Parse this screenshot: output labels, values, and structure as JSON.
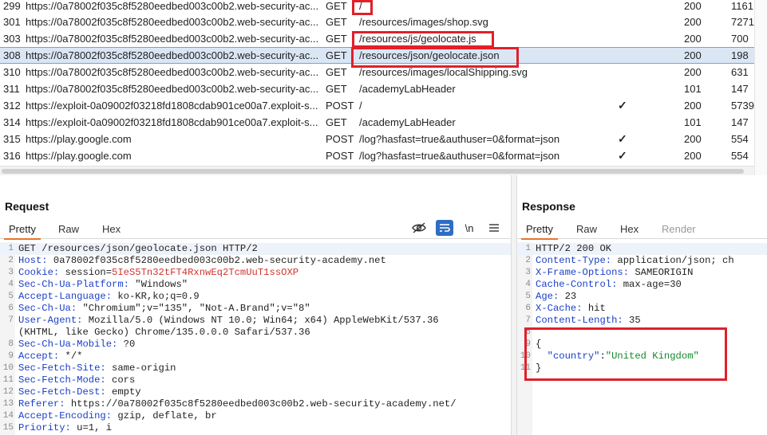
{
  "history": {
    "rows": [
      {
        "num": "299",
        "host": "https://0a78002f035c8f5280eedbed003c00b2.web-security-ac...",
        "method": "GET",
        "url": "/",
        "edited": false,
        "status": "200",
        "length": "1161"
      },
      {
        "num": "301",
        "host": "https://0a78002f035c8f5280eedbed003c00b2.web-security-ac...",
        "method": "GET",
        "url": "/resources/images/shop.svg",
        "edited": false,
        "status": "200",
        "length": "7271"
      },
      {
        "num": "303",
        "host": "https://0a78002f035c8f5280eedbed003c00b2.web-security-ac...",
        "method": "GET",
        "url": "/resources/js/geolocate.js",
        "edited": false,
        "status": "200",
        "length": "700"
      },
      {
        "num": "308",
        "host": "https://0a78002f035c8f5280eedbed003c00b2.web-security-ac...",
        "method": "GET",
        "url": "/resources/json/geolocate.json",
        "edited": false,
        "status": "200",
        "length": "198"
      },
      {
        "num": "310",
        "host": "https://0a78002f035c8f5280eedbed003c00b2.web-security-ac...",
        "method": "GET",
        "url": "/resources/images/localShipping.svg",
        "edited": false,
        "status": "200",
        "length": "631"
      },
      {
        "num": "311",
        "host": "https://0a78002f035c8f5280eedbed003c00b2.web-security-ac...",
        "method": "GET",
        "url": "/academyLabHeader",
        "edited": false,
        "status": "101",
        "length": "147"
      },
      {
        "num": "312",
        "host": "https://exploit-0a09002f03218fd1808cdab901ce00a7.exploit-s...",
        "method": "POST",
        "url": "/",
        "edited": true,
        "status": "200",
        "length": "5739"
      },
      {
        "num": "314",
        "host": "https://exploit-0a09002f03218fd1808cdab901ce00a7.exploit-s...",
        "method": "GET",
        "url": "/academyLabHeader",
        "edited": false,
        "status": "101",
        "length": "147"
      },
      {
        "num": "315",
        "host": "https://play.google.com",
        "method": "POST",
        "url": "/log?hasfast=true&authuser=0&format=json",
        "edited": true,
        "status": "200",
        "length": "554"
      },
      {
        "num": "316",
        "host": "https://play.google.com",
        "method": "POST",
        "url": "/log?hasfast=true&authuser=0&format=json",
        "edited": true,
        "status": "200",
        "length": "554"
      }
    ],
    "check_glyph": "✓"
  },
  "request": {
    "title": "Request",
    "tabs": [
      "Pretty",
      "Raw",
      "Hex"
    ],
    "newline_toggle": "\\n",
    "lines": [
      {
        "n": "1",
        "k": "",
        "v": "GET /resources/json/geolocate.json HTTP/2"
      },
      {
        "n": "2",
        "k": "Host:",
        "v": " 0a78002f035c8f5280eedbed003c00b2.web-security-academy.net"
      },
      {
        "n": "3",
        "k": "Cookie:",
        "v": " session=",
        "cookie": "5IeS5Tn32tFT4RxnwEq2TcmUuT1ssOXP"
      },
      {
        "n": "4",
        "k": "Sec-Ch-Ua-Platform:",
        "v": " \"Windows\""
      },
      {
        "n": "5",
        "k": "Accept-Language:",
        "v": " ko-KR,ko;q=0.9"
      },
      {
        "n": "6",
        "k": "Sec-Ch-Ua:",
        "v": " \"Chromium\";v=\"135\", \"Not-A.Brand\";v=\"8\""
      },
      {
        "n": "7",
        "k": "User-Agent:",
        "v": " Mozilla/5.0 (Windows NT 10.0; Win64; x64) AppleWebKit/537.36"
      },
      {
        "n": "",
        "k": "",
        "v": "(KHTML, like Gecko) Chrome/135.0.0.0 Safari/537.36"
      },
      {
        "n": "8",
        "k": "Sec-Ch-Ua-Mobile:",
        "v": " ?0"
      },
      {
        "n": "9",
        "k": "Accept:",
        "v": " */*"
      },
      {
        "n": "10",
        "k": "Sec-Fetch-Site:",
        "v": " same-origin"
      },
      {
        "n": "11",
        "k": "Sec-Fetch-Mode:",
        "v": " cors"
      },
      {
        "n": "12",
        "k": "Sec-Fetch-Dest:",
        "v": " empty"
      },
      {
        "n": "13",
        "k": "Referer:",
        "v": " https://0a78002f035c8f5280eedbed003c00b2.web-security-academy.net/"
      },
      {
        "n": "14",
        "k": "Accept-Encoding:",
        "v": " gzip, deflate, br"
      },
      {
        "n": "15",
        "k": "Priority:",
        "v": " u=1, i"
      }
    ]
  },
  "response": {
    "title": "Response",
    "tabs": [
      "Pretty",
      "Raw",
      "Hex",
      "Render"
    ],
    "lines": [
      {
        "n": "1",
        "k": "",
        "v": "HTTP/2 200 OK"
      },
      {
        "n": "2",
        "k": "Content-Type:",
        "v": " application/json; ch"
      },
      {
        "n": "3",
        "k": "X-Frame-Options:",
        "v": " SAMEORIGIN"
      },
      {
        "n": "4",
        "k": "Cache-Control:",
        "v": " max-age=30"
      },
      {
        "n": "5",
        "k": "Age:",
        "v": " 23"
      },
      {
        "n": "6",
        "k": "X-Cache:",
        "v": " hit"
      },
      {
        "n": "7",
        "k": "Content-Length:",
        "v": " 35"
      },
      {
        "n": "8",
        "k": "",
        "v": ""
      },
      {
        "n": "9",
        "k": "",
        "v": "{"
      },
      {
        "n": "10",
        "k": "",
        "v": "  ",
        "jkey": "\"country\"",
        "colon": ":",
        "str": "\"United Kingdom\""
      },
      {
        "n": "11",
        "k": "",
        "v": "}"
      }
    ]
  },
  "colors": {
    "highlight": "#e0202a",
    "selected_row": "#dbe6f5",
    "active_tab_underline": "#e8742a",
    "header_key": "#1a3fc7",
    "cookie_value": "#d0342c",
    "json_string": "#138a2c"
  }
}
